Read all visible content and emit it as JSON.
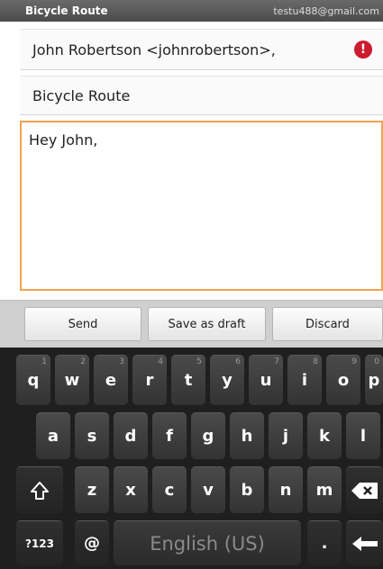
{
  "status": {
    "title": "Bicycle Route",
    "account": "testu488@gmail.com"
  },
  "compose": {
    "to": "John Robertson <johnrobertson>,",
    "subject": "Bicycle Route",
    "body": "Hey John,"
  },
  "actions": {
    "send": "Send",
    "save_draft": "Save as draft",
    "discard": "Discard"
  },
  "keyboard": {
    "row1": [
      {
        "k": "q",
        "h": "1"
      },
      {
        "k": "w",
        "h": "2"
      },
      {
        "k": "e",
        "h": "3"
      },
      {
        "k": "r",
        "h": "4"
      },
      {
        "k": "t",
        "h": "5"
      },
      {
        "k": "y",
        "h": "6"
      },
      {
        "k": "u",
        "h": "7"
      },
      {
        "k": "i",
        "h": "8"
      },
      {
        "k": "o",
        "h": "9"
      },
      {
        "k": "p",
        "h": "0"
      }
    ],
    "row2": [
      "a",
      "s",
      "d",
      "f",
      "g",
      "h",
      "j",
      "k",
      "l"
    ],
    "row3": [
      "z",
      "x",
      "c",
      "v",
      "b",
      "n",
      "m"
    ],
    "num_key": "?123",
    "at_key": "@",
    "space_label": "English (US)",
    "period_key": "."
  },
  "icons": {
    "error": "exclamation-icon",
    "shift": "shift-arrow-icon",
    "backspace": "backspace-icon",
    "enter": "enter-arrow-icon"
  },
  "colors": {
    "body_border": "#f0a34c",
    "error": "#cc1a2e",
    "keyboard_bg": "#1f1f1f"
  }
}
